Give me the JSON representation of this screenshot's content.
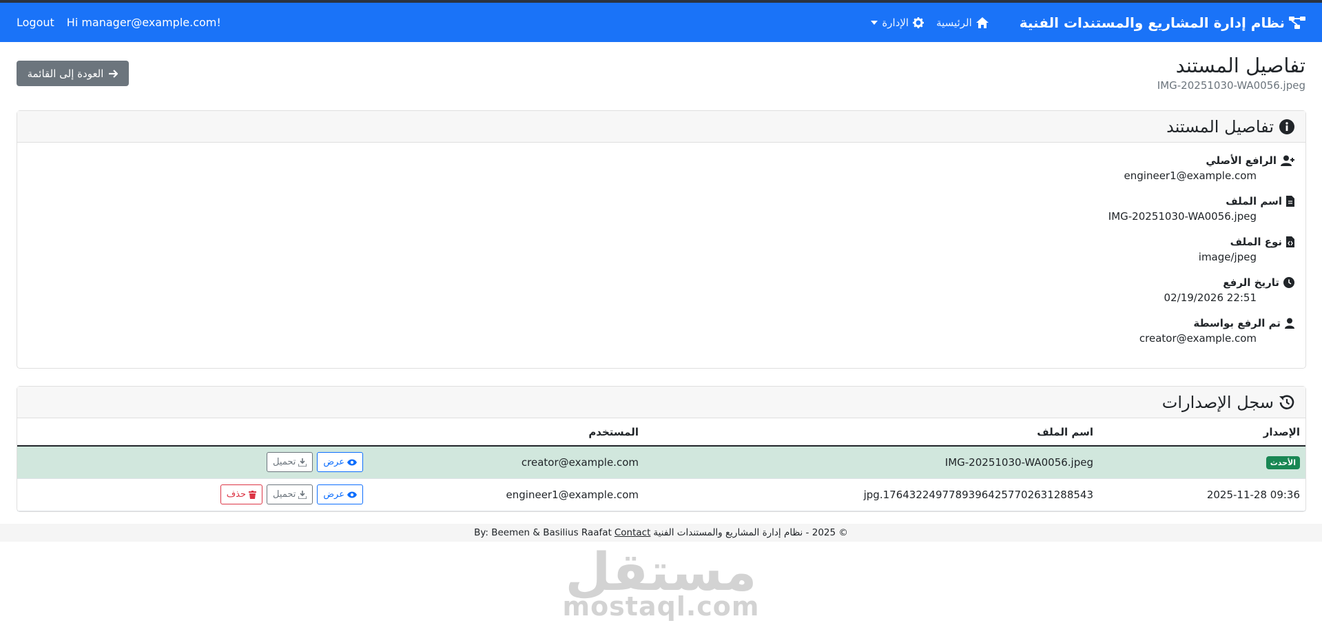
{
  "navbar": {
    "brand": "نظام إدارة المشاريع والمستندات الفنية",
    "home_label": "الرئيسية",
    "admin_label": "الإدارة",
    "greeting": "Hi manager@example.com!",
    "logout_label": "Logout",
    "bg_color": "#1a73f8"
  },
  "page": {
    "title": "تفاصيل المستند",
    "subtitle": "IMG-20251030-WA0056.jpeg",
    "back_label": "العودة إلى القائمة"
  },
  "details_card": {
    "title": "تفاصيل المستند",
    "items": [
      {
        "label": "الرافع الأصلي",
        "value": "engineer1@example.com",
        "icon": "user-plus-icon"
      },
      {
        "label": "اسم الملف",
        "value": "IMG-20251030-WA0056.jpeg",
        "icon": "file-icon"
      },
      {
        "label": "نوع الملف",
        "value": "image/jpeg",
        "icon": "file-code-icon"
      },
      {
        "label": "تاريخ الرفع",
        "value": "02/19/2026 22:51",
        "icon": "clock-icon"
      },
      {
        "label": "تم الرفع بواسطة",
        "value": "creator@example.com",
        "icon": "user-icon"
      }
    ]
  },
  "versions_card": {
    "title": "سجل الإصدارات",
    "headers": {
      "version": "الإصدار",
      "filename": "اسم الملف",
      "user": "المستخدم",
      "actions": ""
    },
    "rows": [
      {
        "version": "",
        "badge": "الأحدث",
        "filename": "IMG-20251030-WA0056.jpeg",
        "user": "creator@example.com",
        "view": "عرض",
        "download": "تحميل",
        "delete": ""
      },
      {
        "version": "2025-11-28 09:36",
        "badge": "",
        "filename": "1764322497789396425770263128854​3.jpg",
        "user": "engineer1@example.com",
        "view": "عرض",
        "download": "تحميل",
        "delete": "حذف"
      }
    ]
  },
  "footer": {
    "copyright": "© 2025 - نظام إدارة المشاريع والمستندات الفنية",
    "contact": "Contact",
    "credits": "By: Beemen & Basilius Raafat"
  },
  "watermark": {
    "arabic": "مستقل",
    "latin": "mostaql.com"
  }
}
